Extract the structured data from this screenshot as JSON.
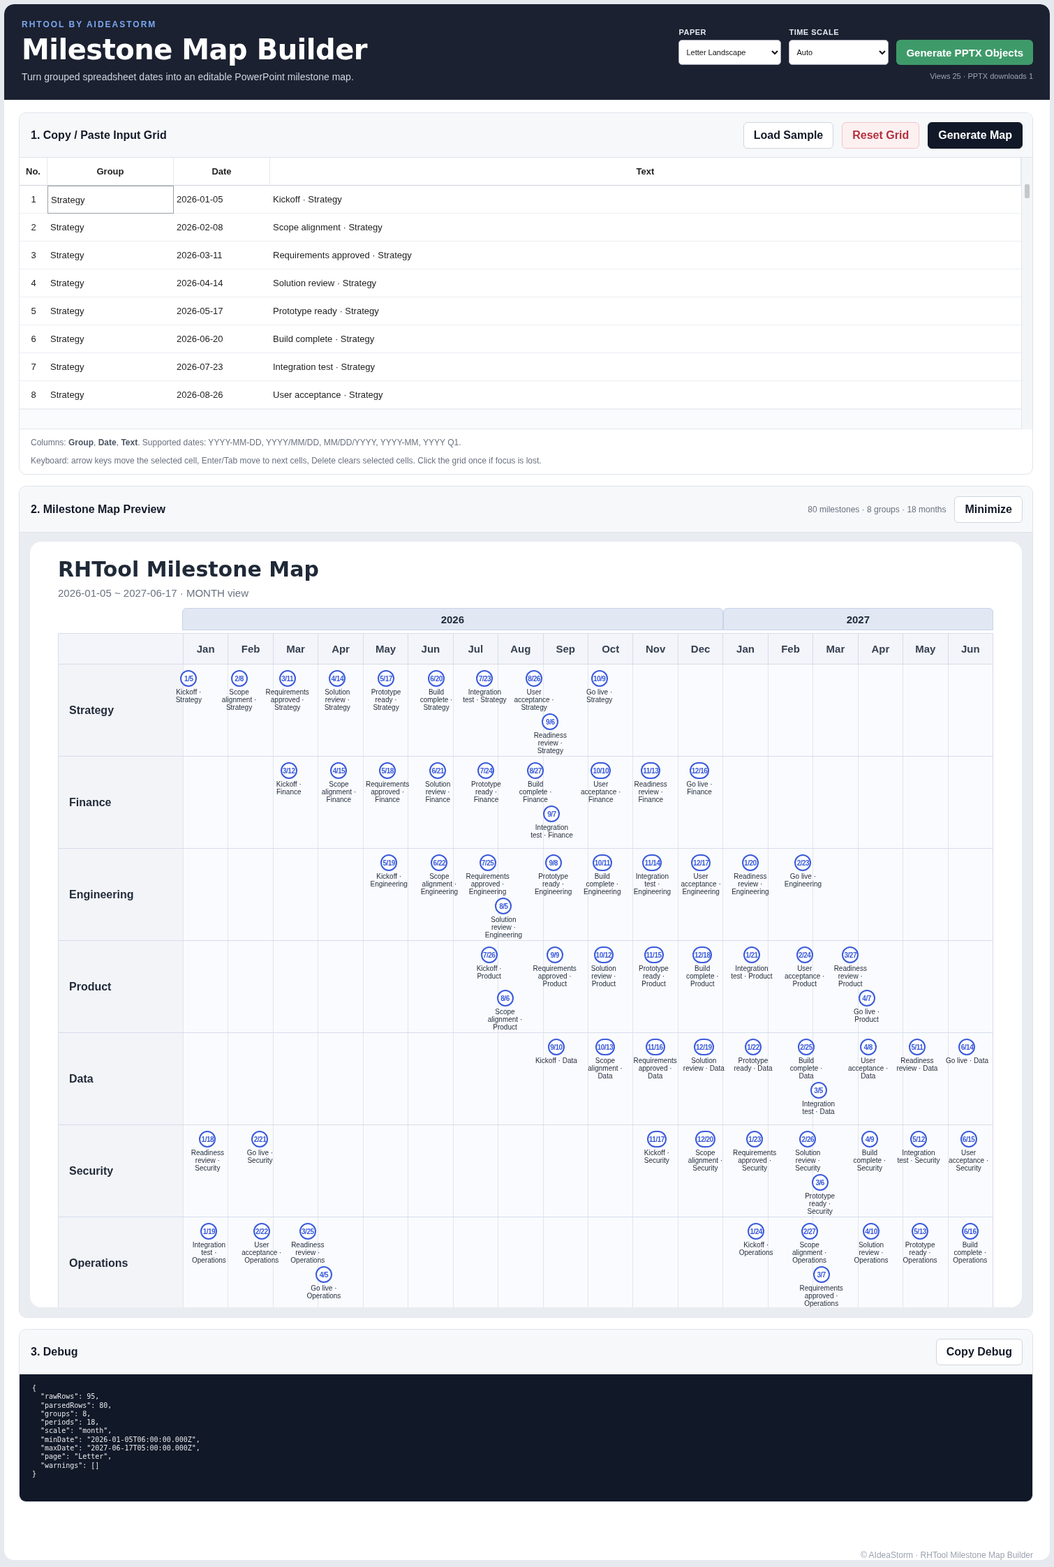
{
  "header": {
    "brand": "RHTOOL BY AIDEASTORM",
    "title": "Milestone Map Builder",
    "subtitle": "Turn grouped spreadsheet dates into an editable PowerPoint milestone map.",
    "selects": [
      {
        "label": "PAPER",
        "value": "Letter Landscape"
      },
      {
        "label": "TIME SCALE",
        "value": "Auto"
      }
    ],
    "action": "Generate PPTX Objects",
    "stats": "Views 25 · PPTX downloads 1"
  },
  "input_grid": {
    "title": "1. Copy / Paste Input Grid",
    "buttons": [
      {
        "label": "Load Sample",
        "kind": "secondary"
      },
      {
        "label": "Reset Grid",
        "kind": "danger"
      },
      {
        "label": "Generate Map",
        "kind": "primary"
      }
    ],
    "columns": [
      "No.",
      "Group",
      "Date",
      "Text"
    ],
    "rows": [
      {
        "no": "1",
        "group": "Strategy",
        "date": "2026-01-05",
        "text": "Kickoff · Strategy",
        "selected": true
      },
      {
        "no": "2",
        "group": "Strategy",
        "date": "2026-02-08",
        "text": "Scope alignment · Strategy",
        "selected": false
      },
      {
        "no": "3",
        "group": "Strategy",
        "date": "2026-03-11",
        "text": "Requirements approved · Strategy",
        "selected": false
      },
      {
        "no": "4",
        "group": "Strategy",
        "date": "2026-04-14",
        "text": "Solution review · Strategy",
        "selected": false
      },
      {
        "no": "5",
        "group": "Strategy",
        "date": "2026-05-17",
        "text": "Prototype ready · Strategy",
        "selected": false
      },
      {
        "no": "6",
        "group": "Strategy",
        "date": "2026-06-20",
        "text": "Build complete · Strategy",
        "selected": false
      },
      {
        "no": "7",
        "group": "Strategy",
        "date": "2026-07-23",
        "text": "Integration test · Strategy",
        "selected": false
      },
      {
        "no": "8",
        "group": "Strategy",
        "date": "2026-08-26",
        "text": "User acceptance · Strategy",
        "selected": false
      }
    ],
    "notes": [
      "Columns: **Group**, **Date**, **Text**. Supported dates: YYYY-MM-DD, YYYY/MM/DD, MM/DD/YYYY, YYYY-MM, YYYY Q1.",
      "Keyboard: arrow keys move the selected cell, Enter/Tab move to next cells, Delete clears selected cells. Click the grid once if focus is lost."
    ]
  },
  "preview": {
    "title": "2. Milestone Map Preview",
    "summary": "80 milestones · 8 groups · 18 months",
    "button": "Minimize",
    "map": {
      "title": "RHTool Milestone Map",
      "subtitle": "2026-01-05 ~ 2027-06-17 · MONTH view",
      "years": [
        {
          "label": "2026",
          "months": [
            "Jan",
            "Feb",
            "Mar",
            "Apr",
            "May",
            "Jun",
            "Jul",
            "Aug",
            "Sep",
            "Oct",
            "Nov",
            "Dec"
          ]
        },
        {
          "label": "2027",
          "months": [
            "Jan",
            "Feb",
            "Mar",
            "Apr",
            "May",
            "Jun"
          ]
        }
      ],
      "groups": [
        {
          "name": "Strategy",
          "milestones": [
            {
              "date": "1/5",
              "label": "Kickoff · Strategy"
            },
            {
              "date": "2/8",
              "label": "Scope alignment · Strategy"
            },
            {
              "date": "3/11",
              "label": "Requirements approved · Strategy"
            },
            {
              "date": "4/14",
              "label": "Solution review · Strategy"
            },
            {
              "date": "5/17",
              "label": "Prototype ready · Strategy"
            },
            {
              "date": "6/20",
              "label": "Build complete · Strategy"
            },
            {
              "date": "7/23",
              "label": "Integration test · Strategy"
            },
            {
              "date": "8/26",
              "label": "User acceptance · Strategy"
            },
            {
              "date": "9/6",
              "label": "Readiness review · Strategy"
            },
            {
              "date": "10/9",
              "label": "Go live · Strategy"
            }
          ]
        },
        {
          "name": "Finance",
          "milestones": [
            {
              "date": "3/12",
              "label": "Kickoff · Finance"
            },
            {
              "date": "4/15",
              "label": "Scope alignment · Finance"
            },
            {
              "date": "5/18",
              "label": "Requirements approved · Finance"
            },
            {
              "date": "6/21",
              "label": "Solution review · Finance"
            },
            {
              "date": "7/24",
              "label": "Prototype ready · Finance"
            },
            {
              "date": "8/27",
              "label": "Build complete · Finance"
            },
            {
              "date": "9/7",
              "label": "Integration test · Finance"
            },
            {
              "date": "10/10",
              "label": "User acceptance · Finance"
            },
            {
              "date": "11/13",
              "label": "Readiness review · Finance"
            },
            {
              "date": "12/16",
              "label": "Go live · Finance"
            }
          ]
        },
        {
          "name": "Engineering",
          "milestones": [
            {
              "date": "5/19",
              "label": "Kickoff · Engineering"
            },
            {
              "date": "6/22",
              "label": "Scope alignment · Engineering"
            },
            {
              "date": "7/25",
              "label": "Requirements approved · Engineering"
            },
            {
              "date": "8/5",
              "label": "Solution review · Engineering"
            },
            {
              "date": "9/8",
              "label": "Prototype ready · Engineering"
            },
            {
              "date": "10/11",
              "label": "Build complete · Engineering"
            },
            {
              "date": "11/14",
              "label": "Integration test · Engineering"
            },
            {
              "date": "12/17",
              "label": "User acceptance · Engineering"
            },
            {
              "date": "1/20",
              "label": "Readiness review · Engineering"
            },
            {
              "date": "2/23",
              "label": "Go live · Engineering"
            }
          ]
        },
        {
          "name": "Product",
          "milestones": [
            {
              "date": "7/26",
              "label": "Kickoff · Product"
            },
            {
              "date": "8/6",
              "label": "Scope alignment · Product"
            },
            {
              "date": "9/9",
              "label": "Requirements approved · Product"
            },
            {
              "date": "10/12",
              "label": "Solution review · Product"
            },
            {
              "date": "11/15",
              "label": "Prototype ready · Product"
            },
            {
              "date": "12/18",
              "label": "Build complete · Product"
            },
            {
              "date": "1/21",
              "label": "Integration test · Product"
            },
            {
              "date": "2/24",
              "label": "User acceptance · Product"
            },
            {
              "date": "3/27",
              "label": "Readiness review · Product"
            },
            {
              "date": "4/7",
              "label": "Go live · Product"
            }
          ]
        },
        {
          "name": "Data",
          "milestones": [
            {
              "date": "9/10",
              "label": "Kickoff · Data"
            },
            {
              "date": "10/13",
              "label": "Scope alignment · Data"
            },
            {
              "date": "11/16",
              "label": "Requirements approved · Data"
            },
            {
              "date": "12/19",
              "label": "Solution review · Data"
            },
            {
              "date": "1/22",
              "label": "Prototype ready · Data"
            },
            {
              "date": "2/25",
              "label": "Build complete · Data"
            },
            {
              "date": "3/5",
              "label": "Integration test · Data"
            },
            {
              "date": "4/8",
              "label": "User acceptance · Data"
            },
            {
              "date": "5/11",
              "label": "Readiness review · Data"
            },
            {
              "date": "6/14",
              "label": "Go live · Data"
            }
          ]
        },
        {
          "name": "Security",
          "milestones": [
            {
              "date": "1/18",
              "label": "Readiness review · Security"
            },
            {
              "date": "2/21",
              "label": "Go live · Security"
            },
            {
              "date": "11/17",
              "label": "Kickoff · Security"
            },
            {
              "date": "12/20",
              "label": "Scope alignment · Security"
            },
            {
              "date": "1/23",
              "label": "Requirements approved · Security"
            },
            {
              "date": "2/26",
              "label": "Solution review · Security"
            },
            {
              "date": "3/6",
              "label": "Prototype ready · Security"
            },
            {
              "date": "4/9",
              "label": "Build complete · Security"
            },
            {
              "date": "5/12",
              "label": "Integration test · Security"
            },
            {
              "date": "6/15",
              "label": "User acceptance · Security"
            }
          ]
        },
        {
          "name": "Operations",
          "milestones": [
            {
              "date": "1/19",
              "label": "Integration test · Operations"
            },
            {
              "date": "2/22",
              "label": "User acceptance · Operations"
            },
            {
              "date": "3/25",
              "label": "Readiness review · Operations"
            },
            {
              "date": "4/5",
              "label": "Go live · Operations"
            },
            {
              "date": "1/24",
              "label": "Kickoff · Operations"
            },
            {
              "date": "2/27",
              "label": "Scope alignment · Operations"
            },
            {
              "date": "3/7",
              "label": "Requirements approved · Operations"
            },
            {
              "date": "4/10",
              "label": "Solution review · Operations"
            },
            {
              "date": "5/13",
              "label": "Prototype ready · Operations"
            },
            {
              "date": "6/16",
              "label": "Build complete · Operations"
            }
          ]
        }
      ]
    }
  },
  "debug": {
    "title": "3. Debug",
    "button": "Copy Debug",
    "text": "{\n  \"rawRows\": 95,\n  \"parsedRows\": 80,\n  \"groups\": 8,\n  \"periods\": 18,\n  \"scale\": \"month\",\n  \"minDate\": \"2026-01-05T06:00:00.000Z\",\n  \"maxDate\": \"2027-06-17T05:00:00.000Z\",\n  \"page\": \"Letter\",\n  \"warnings\": []\n}"
  },
  "footer": "© AIdeaStorm · RHTool Milestone Map Builder"
}
